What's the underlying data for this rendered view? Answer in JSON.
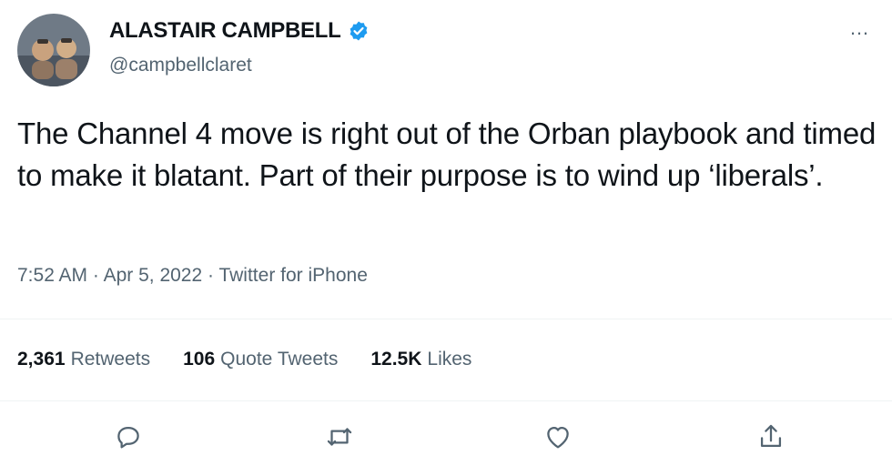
{
  "author": {
    "display_name": "ALASTAIR CAMPBELL",
    "handle": "@campbellclaret",
    "verified": true,
    "avatar": "profile-photo"
  },
  "tweet": {
    "text": "The Channel 4 move is right out of the Orban playbook and timed to make it blatant. Part of their purpose is to wind up ‘liberals’.",
    "time": "7:52 AM",
    "separator1": " · ",
    "date": "Apr 5, 2022",
    "separator2": " · ",
    "source": "Twitter for iPhone"
  },
  "more_menu": {
    "label": "…",
    "icon": "more-icon"
  },
  "stats": {
    "retweets_count": "2,361",
    "retweets_label": "Retweets",
    "quotes_count": "106",
    "quotes_label": "Quote Tweets",
    "likes_count": "12.5K",
    "likes_label": "Likes"
  },
  "actions": [
    "reply-icon",
    "retweet-icon",
    "like-icon",
    "share-icon"
  ],
  "colors": {
    "text": "#0f1419",
    "secondary": "#536471",
    "verified": "#1d9bf0",
    "divider": "#eff3f4"
  }
}
